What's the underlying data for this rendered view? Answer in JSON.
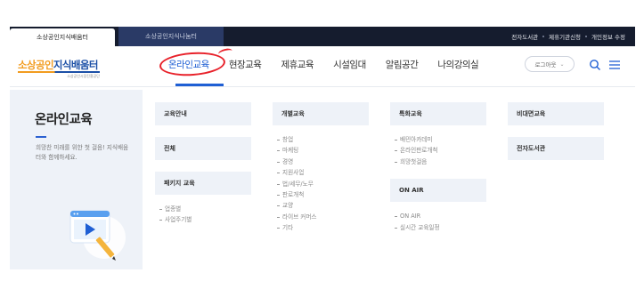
{
  "topbar": {
    "tabs": [
      "소상공인지식배움터",
      "소상공인지식나눔터"
    ],
    "utility_links": [
      "전자도서관",
      "제휴기관신청",
      "개인정보 수정"
    ]
  },
  "header": {
    "logo": {
      "text_orange": "소상공인",
      "text_blue": "지식배움터",
      "sub": "소상공인시장진흥공단"
    },
    "nav": [
      "온라인교육",
      "현장교육",
      "제휴교육",
      "시설임대",
      "알림공간",
      "나의강의실"
    ],
    "logout_label": "로그아웃",
    "icons": [
      "search-icon",
      "menu-icon"
    ]
  },
  "side": {
    "title": "온라인교육",
    "description": "희망찬 미래를 위한 첫 걸음! 지식배움터와 함께하세요."
  },
  "menu": {
    "col1": [
      {
        "title": "교육안내",
        "items": []
      },
      {
        "title": "전체",
        "items": []
      },
      {
        "title": "패키지 교육",
        "items": [
          "업종별",
          "사업주기별"
        ]
      }
    ],
    "col2": [
      {
        "title": "개별교육",
        "items": [
          "창업",
          "마케팅",
          "경영",
          "지원사업",
          "법/세무/노무",
          "판로개척",
          "교양",
          "라이브 커머스",
          "기타"
        ]
      }
    ],
    "col3": [
      {
        "title": "특화교육",
        "items": [
          "배민아카데미",
          "온라인판로개척",
          "희망첫걸음"
        ]
      },
      {
        "title": "ON AIR",
        "items": [
          "ON AIR",
          "실시간 교육일정"
        ]
      }
    ],
    "col4": [
      {
        "title": "비대면교육",
        "items": []
      },
      {
        "title": "전자도서관",
        "items": []
      }
    ]
  },
  "colors": {
    "accent": "#1f5fd4",
    "brand_orange": "#f29c1f",
    "brand_blue": "#1b4fa6",
    "highlight_red": "#e8212a",
    "topbar": "#151c2e"
  }
}
